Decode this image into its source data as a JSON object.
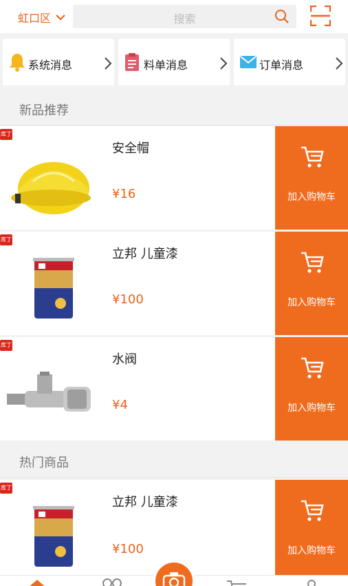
{
  "header": {
    "district": "虹口区",
    "search_placeholder": "搜索"
  },
  "messages": [
    {
      "label": "系统消息",
      "icon": "bell-icon"
    },
    {
      "label": "料单消息",
      "icon": "clipboard-icon"
    },
    {
      "label": "订单消息",
      "icon": "envelope-icon"
    }
  ],
  "sections": {
    "new": "新品推荐",
    "hot": "热门商品"
  },
  "products_new": [
    {
      "name": "安全帽",
      "price": "¥16",
      "badge": "库丁",
      "cart_label": "加入购物车"
    },
    {
      "name": "立邦 儿童漆",
      "price": "¥100",
      "badge": "库丁",
      "cart_label": "加入购物车"
    },
    {
      "name": "水阀",
      "price": "¥4",
      "badge": "库丁",
      "cart_label": "加入购物车"
    }
  ],
  "products_hot": [
    {
      "name": "立邦 儿童漆",
      "price": "¥100",
      "badge": "库丁",
      "cart_label": "加入购物车"
    }
  ],
  "colors": {
    "accent": "#ef6b1e",
    "price": "#e8641b",
    "badge": "#d9271c"
  }
}
